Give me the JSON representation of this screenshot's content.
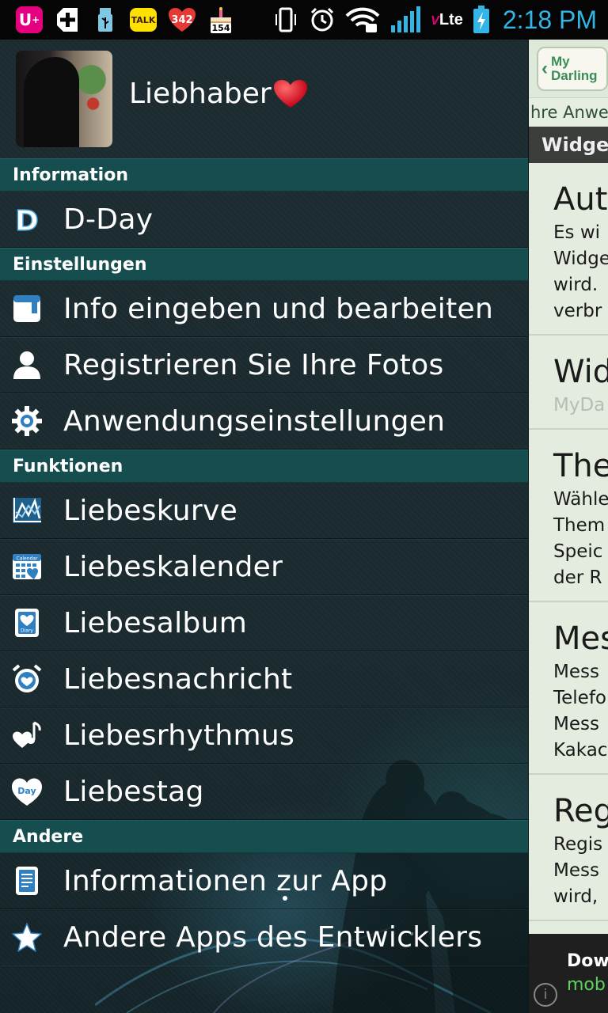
{
  "status_bar": {
    "time": "2:18 PM",
    "badge_count": "342",
    "cake_number": "154",
    "kakao_label": "TALK",
    "network": "Lte",
    "icons": [
      "uplus-icon",
      "add-icon",
      "usb-icon",
      "kakaotalk-icon",
      "heart-badge-icon",
      "cake-icon",
      "vibrate-icon",
      "alarm-icon",
      "wifi-lock-icon",
      "signal-icon",
      "volte-icon",
      "battery-charging-icon"
    ]
  },
  "profile": {
    "name": "Liebhaber",
    "heart": "❤"
  },
  "sections": {
    "information": "Information",
    "settings": "Einstellungen",
    "functions": "Funktionen",
    "other": "Andere"
  },
  "menu": {
    "dday": "D-Day",
    "edit_info": "Info eingeben und bearbeiten",
    "register_photos": "Registrieren Sie Ihre Fotos",
    "app_settings": "Anwendungseinstellungen",
    "love_curve": "Liebeskurve",
    "love_calendar": "Liebeskalender",
    "love_album": "Liebesalbum",
    "love_message": "Liebesnachricht",
    "love_rhythm": "Liebesrhythmus",
    "love_day": "Liebestag",
    "app_info": "Informationen zur App",
    "other_apps": "Andere Apps des Entwicklers"
  },
  "icon_text": {
    "dday_letter": "D",
    "calendar_word": "Calendar",
    "diary_word": "Diary",
    "day_word": "Day"
  },
  "behind": {
    "logo_line1": "My",
    "logo_line2": "Darling",
    "subtitle": "hre Anwe",
    "bar": "Widget",
    "cards": [
      {
        "title": "Aut",
        "lines": [
          "Es wi",
          "Widge",
          "wird.",
          "verbr"
        ]
      },
      {
        "title": "Wid",
        "gray": "MyDa"
      },
      {
        "title": "The",
        "lines": [
          "Wähle",
          "Them",
          "Speic",
          "der R"
        ]
      },
      {
        "title": "Mes",
        "lines": [
          "Mess",
          "Telefo",
          "Mess",
          "Kakac"
        ]
      },
      {
        "title": "Reg",
        "lines": [
          "Regis",
          "Mess",
          "wird,"
        ]
      }
    ],
    "ad_line1": "Dow",
    "ad_line2": "mob",
    "ad_info": "i"
  },
  "colors": {
    "section_bg": "#164e50",
    "drawer_bg": "#1c2b30",
    "icon_color": "#ffffff",
    "time_color": "#33b5e5",
    "accent_heart": "#e0202a"
  }
}
